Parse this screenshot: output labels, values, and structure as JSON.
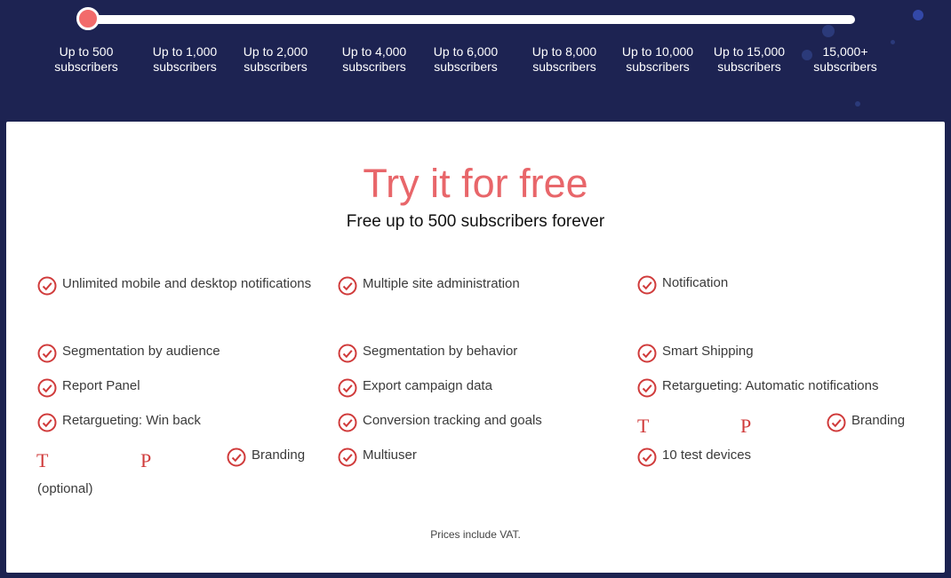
{
  "slider": {
    "selected_index": 0,
    "tiers": [
      [
        "Up to 500",
        "subscribers"
      ],
      [
        "Up to 1,000",
        "subscribers"
      ],
      [
        "Up to 2,000",
        "subscribers"
      ],
      [
        "Up to 4,000",
        "subscribers"
      ],
      [
        "Up to 6,000",
        "subscribers"
      ],
      [
        "Up to 8,000",
        "subscribers"
      ],
      [
        "Up to 10,000",
        "subscribers"
      ],
      [
        "Up to 15,000",
        "subscribers"
      ],
      [
        "15,000+",
        "subscribers"
      ]
    ]
  },
  "plan": {
    "title": "Try it for free",
    "subtitle": "Free up to 500 subscribers forever",
    "vat_note": "Prices include VAT.",
    "optional_note": "(optional)",
    "glyph_t": "T",
    "glyph_p": "P"
  },
  "features": {
    "col1": [
      "Unlimited mobile and desktop notifications",
      "Segmentation by audience",
      "Report Panel",
      "Retargueting: Win back",
      "Branding"
    ],
    "col2": [
      "Multiple site administration",
      "Segmentation by behavior",
      "Export campaign data",
      "Conversion tracking and goals",
      "Multiuser"
    ],
    "col3": [
      "Notification",
      "Smart Shipping",
      "Retargueting: Automatic notifications",
      "Branding",
      "10 test devices"
    ]
  },
  "colors": {
    "accent": "#e8666a",
    "check": "#d03b3b",
    "background": "#1d2352"
  },
  "icons": {
    "check": "check-circle-icon"
  }
}
